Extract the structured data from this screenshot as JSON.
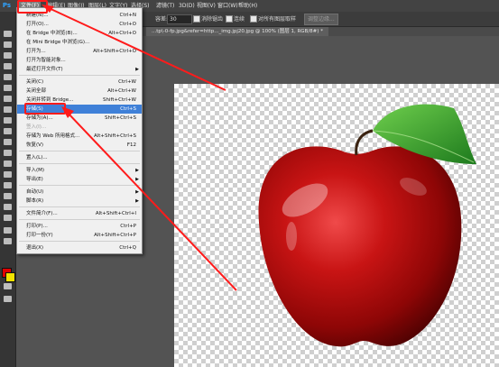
{
  "app": {
    "logo": "Ps"
  },
  "menubar": {
    "items": [
      "文件(F)",
      "编辑(E)",
      "图像(I)",
      "图层(L)",
      "文字(Y)",
      "选择(S)",
      "滤镜(T)",
      "3D(D)",
      "视图(V)",
      "窗口(W)",
      "帮助(H)"
    ]
  },
  "options": {
    "tolerance_label": "容差:",
    "tolerance_value": "30",
    "antialias_label": "消除锯齿",
    "contiguous_label": "连续",
    "sample_all_label": "对所有图层取样",
    "refine_edge_button": "调整边缘..."
  },
  "document": {
    "tab_title": "...tp\\-0-fp.jpg&refer=http..._img.jpj20.jpg @ 100% (图层 1, RGB/8#) *"
  },
  "file_menu": {
    "items": [
      {
        "label": "新建(N)...",
        "shortcut": "Ctrl+N"
      },
      {
        "label": "打开(O)...",
        "shortcut": "Ctrl+O"
      },
      {
        "label": "在 Bridge 中浏览(B)...",
        "shortcut": "Alt+Ctrl+O"
      },
      {
        "label": "在 Mini Bridge 中浏览(G)...",
        "shortcut": ""
      },
      {
        "label": "打开为...",
        "shortcut": "Alt+Shift+Ctrl+O"
      },
      {
        "label": "打开为智能对象...",
        "shortcut": ""
      },
      {
        "label": "最近打开文件(T)",
        "shortcut": ""
      },
      {
        "label": "关闭(C)",
        "shortcut": "Ctrl+W"
      },
      {
        "label": "关闭全部",
        "shortcut": "Alt+Ctrl+W"
      },
      {
        "label": "关闭并转到 Bridge...",
        "shortcut": "Shift+Ctrl+W"
      },
      {
        "label": "存储(S)",
        "shortcut": "Ctrl+S"
      },
      {
        "label": "存储为(A)...",
        "shortcut": "Shift+Ctrl+S"
      },
      {
        "label": "签入(I)...",
        "shortcut": ""
      },
      {
        "label": "存储为 Web 所用格式...",
        "shortcut": "Alt+Shift+Ctrl+S"
      },
      {
        "label": "恢复(V)",
        "shortcut": "F12"
      },
      {
        "label": "置入(L)...",
        "shortcut": ""
      },
      {
        "label": "导入(M)",
        "shortcut": ""
      },
      {
        "label": "导出(E)",
        "shortcut": ""
      },
      {
        "label": "自动(U)",
        "shortcut": ""
      },
      {
        "label": "脚本(R)",
        "shortcut": ""
      },
      {
        "label": "文件简介(F)...",
        "shortcut": "Alt+Shift+Ctrl+I"
      },
      {
        "label": "打印(P)...",
        "shortcut": "Ctrl+P"
      },
      {
        "label": "打印一份(Y)",
        "shortcut": "Alt+Shift+Ctrl+P"
      },
      {
        "label": "退出(X)",
        "shortcut": "Ctrl+Q"
      }
    ]
  },
  "colors": {
    "accent_annotation": "#ff1b1b",
    "foreground_swatch": "#e10000",
    "background_swatch": "#f2e200",
    "menu_highlight": "#3f80d8"
  },
  "icons": [
    "ps-logo-icon",
    "submenu-arrow-icon",
    "apple-image"
  ]
}
